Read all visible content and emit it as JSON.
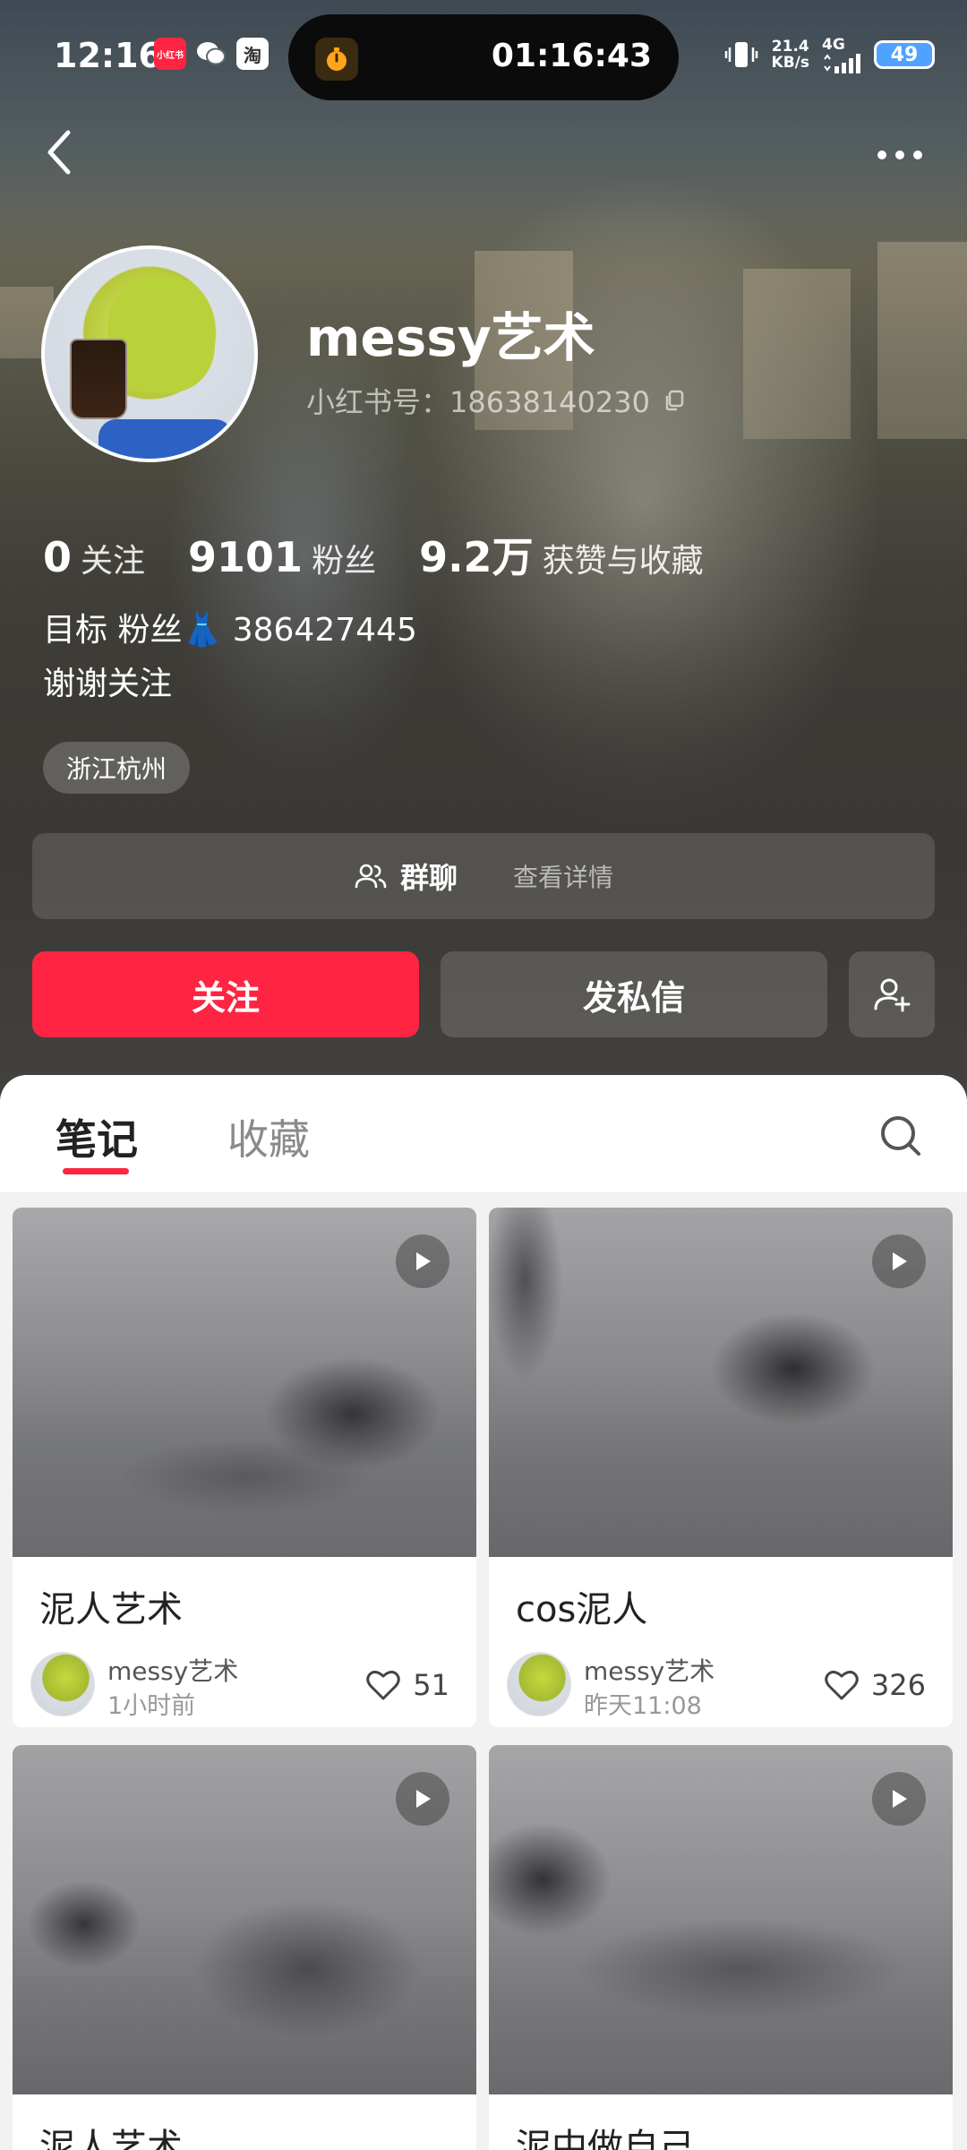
{
  "status_bar": {
    "time": "12:16",
    "apps": [
      "小红书",
      "微信",
      "淘"
    ],
    "island_timer": "01:16:43",
    "net_speed_value": "21.4",
    "net_speed_unit": "KB/s",
    "network": "4G",
    "battery": "49"
  },
  "profile": {
    "username": "messy艺术",
    "red_id": "小红书号：18638140230",
    "stats": [
      {
        "value": "0",
        "label": "关注"
      },
      {
        "value": "9101",
        "label": "粉丝"
      },
      {
        "value": "9.2万",
        "label": "获赞与收藏"
      }
    ],
    "bio_line1": "目标 粉丝👗 386427445",
    "bio_line2": "谢谢关注",
    "location": "浙江杭州"
  },
  "group_chat": {
    "label": "群聊",
    "detail": "查看详情"
  },
  "actions": {
    "follow": "关注",
    "message": "发私信"
  },
  "tabs": [
    {
      "label": "笔记",
      "active": true
    },
    {
      "label": "收藏",
      "active": false
    }
  ],
  "notes": [
    {
      "title": "泥人艺术",
      "author": "messy艺术",
      "time": "1小时前",
      "likes": "51"
    },
    {
      "title": "cos泥人",
      "author": "messy艺术",
      "time": "昨天11:08",
      "likes": "326"
    },
    {
      "title": "泥人艺术"
    },
    {
      "title": "泥中做自己"
    }
  ],
  "colors": {
    "accent": "#ff2442",
    "battery": "#4fa3ff"
  }
}
